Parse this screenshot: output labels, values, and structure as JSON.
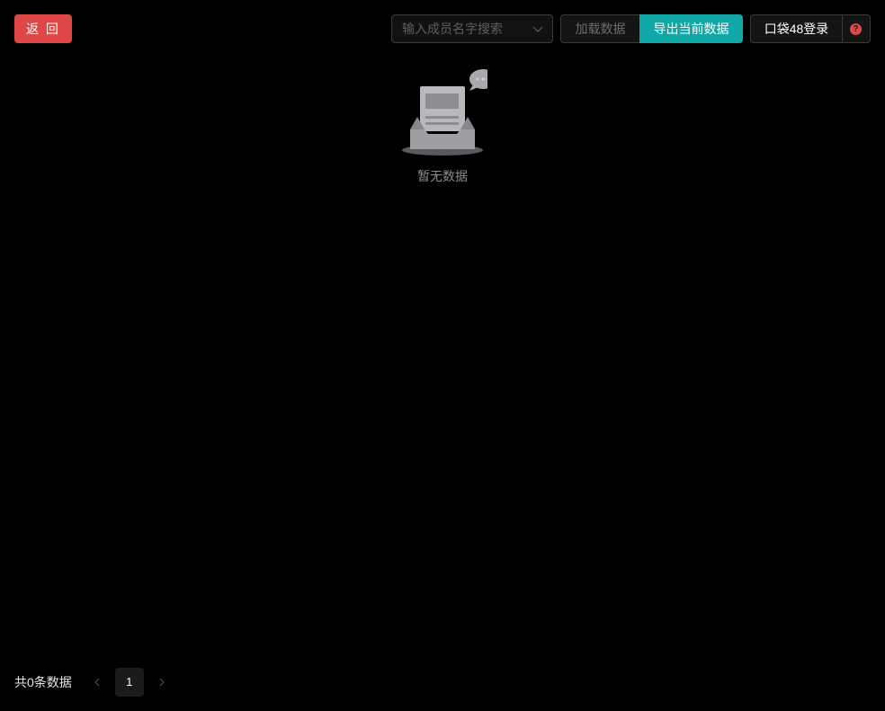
{
  "toolbar": {
    "back_label": "返 回",
    "search_placeholder": "输入成员名字搜索",
    "load_label": "加载数据",
    "export_label": "导出当前数据",
    "login_label": "口袋48登录",
    "help_glyph": "?"
  },
  "empty_state": {
    "text": "暂无数据",
    "icon": "empty-inbox-icon"
  },
  "pagination": {
    "total_label": "共0条数据",
    "current_page": "1",
    "prev_icon": "chevron-left-icon",
    "next_icon": "chevron-right-icon"
  },
  "colors": {
    "background": "#000000",
    "back_button": "#e04848",
    "export_button": "#13a8a8",
    "help_icon": "#e04848"
  }
}
